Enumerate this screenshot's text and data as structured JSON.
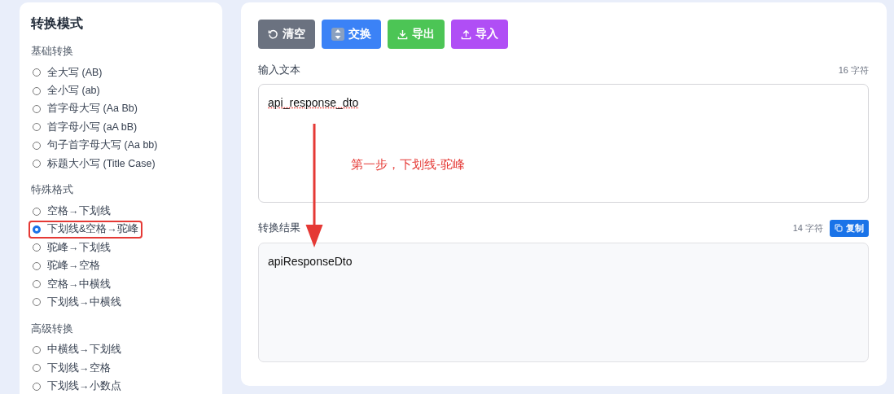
{
  "sidebar": {
    "title": "转换模式",
    "groups": [
      {
        "label": "基础转换",
        "items": [
          {
            "label": "全大写 (AB)",
            "selected": false,
            "highlighted": false
          },
          {
            "label": "全小写 (ab)",
            "selected": false,
            "highlighted": false
          },
          {
            "label": "首字母大写 (Aa Bb)",
            "selected": false,
            "highlighted": false
          },
          {
            "label": "首字母小写 (aA bB)",
            "selected": false,
            "highlighted": false
          },
          {
            "label": "句子首字母大写 (Aa bb)",
            "selected": false,
            "highlighted": false
          },
          {
            "label": "标题大小写 (Title Case)",
            "selected": false,
            "highlighted": false
          }
        ]
      },
      {
        "label": "特殊格式",
        "items": [
          {
            "label": "空格→下划线",
            "selected": false,
            "highlighted": false
          },
          {
            "label": "下划线&空格→驼峰",
            "selected": true,
            "highlighted": true
          },
          {
            "label": "驼峰→下划线",
            "selected": false,
            "highlighted": false
          },
          {
            "label": "驼峰→空格",
            "selected": false,
            "highlighted": false
          },
          {
            "label": "空格→中横线",
            "selected": false,
            "highlighted": false
          },
          {
            "label": "下划线→中横线",
            "selected": false,
            "highlighted": false
          }
        ]
      },
      {
        "label": "高级转换",
        "items": [
          {
            "label": "中横线→下划线",
            "selected": false,
            "highlighted": false
          },
          {
            "label": "下划线→空格",
            "selected": false,
            "highlighted": false
          },
          {
            "label": "下划线→小数点",
            "selected": false,
            "highlighted": false
          }
        ]
      }
    ]
  },
  "toolbar": [
    {
      "kind": "clear",
      "label": "清空"
    },
    {
      "kind": "swap",
      "label": "交换"
    },
    {
      "kind": "export",
      "label": "导出"
    },
    {
      "kind": "import",
      "label": "导入"
    }
  ],
  "input": {
    "label": "输入文本",
    "count": "16 字符",
    "value": "api_response_dto"
  },
  "output": {
    "label": "转换结果",
    "count": "14 字符",
    "copy_label": "复制",
    "value": "apiResponseDto"
  },
  "annotation": {
    "text": "第一步，下划线-驼峰"
  }
}
